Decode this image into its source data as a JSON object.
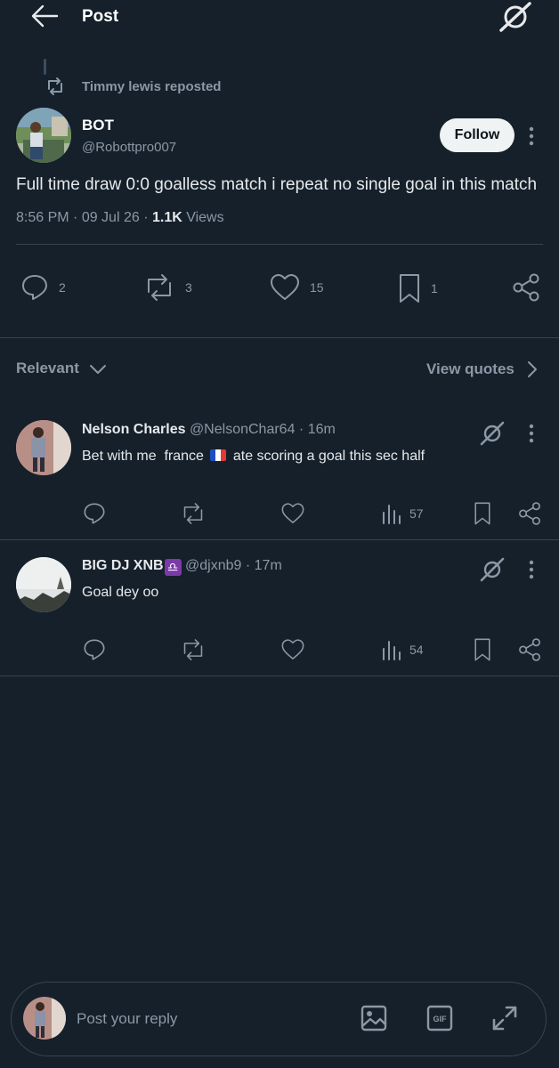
{
  "header": {
    "title": "Post"
  },
  "repost": {
    "text": "Timmy lewis reposted"
  },
  "post": {
    "author_name": "BOT",
    "author_handle": "@Robottpro007",
    "follow_label": "Follow",
    "text": "Full time draw 0:0 goalless match i repeat no single goal in this match",
    "time": "8:56 PM",
    "date": "09 Jul 26",
    "views_count": "1.1K",
    "views_label": "Views",
    "replies": "2",
    "reposts": "3",
    "likes": "15",
    "bookmarks": "1"
  },
  "filter": {
    "sort_label": "Relevant",
    "view_quotes_label": "View quotes"
  },
  "replies": [
    {
      "name": "Nelson Charles",
      "handle": "@NelsonChar64",
      "time": "16m",
      "text_before": "Bet with me  france",
      "text_after": "ate scoring a goal this sec half",
      "views": "57"
    },
    {
      "name": "BIG DJ XNB",
      "badge": "♎",
      "handle": "@djxnb9",
      "time": "17m",
      "text": "Goal dey oo",
      "views": "54"
    }
  ],
  "reply_bar": {
    "placeholder": "Post your reply"
  },
  "colors": {
    "background": "#15202b",
    "muted": "#8b98a5",
    "divider": "#38444d",
    "follow_bg": "#eff3f4"
  }
}
